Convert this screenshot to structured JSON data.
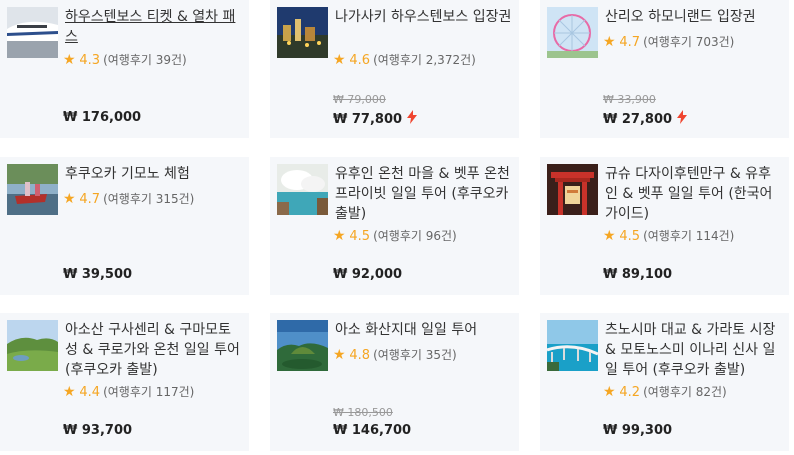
{
  "products": [
    {
      "title": "하우스텐보스 티켓 & 열차 패스",
      "score": "4.3",
      "reviews": "(여행후기 39건)",
      "original_price": "",
      "price": "₩ 176,000",
      "deal": false
    },
    {
      "title": "나가사키 하우스텐보스 입장권",
      "score": "4.6",
      "reviews": "(여행후기 2,372건)",
      "original_price": "₩ 79,000",
      "price": "₩ 77,800",
      "deal": true
    },
    {
      "title": "산리오 하모니랜드 입장권",
      "score": "4.7",
      "reviews": "(여행후기 703건)",
      "original_price": "₩ 33,900",
      "price": "₩ 27,800",
      "deal": true
    },
    {
      "title": "후쿠오카 기모노 체험",
      "score": "4.7",
      "reviews": "(여행후기 315건)",
      "original_price": "",
      "price": "₩ 39,500",
      "deal": false
    },
    {
      "title": "유후인 온천 마을 & 벳푸 온천 프라이빗 일일 투어 (후쿠오카 출발)",
      "score": "4.5",
      "reviews": "(여행후기 96건)",
      "original_price": "",
      "price": "₩ 92,000",
      "deal": false
    },
    {
      "title": "규슈 다자이후텐만구 & 유후인 & 벳푸 일일 투어 (한국어 가이드)",
      "score": "4.5",
      "reviews": "(여행후기 114건)",
      "original_price": "",
      "price": "₩ 89,100",
      "deal": false
    },
    {
      "title": "아소산 구사센리 & 구마모토성 & 쿠로가와 온천 일일 투어 (후쿠오카 출발)",
      "score": "4.4",
      "reviews": "(여행후기 117건)",
      "original_price": "",
      "price": "₩ 93,700",
      "deal": false
    },
    {
      "title": "아소 화산지대 일일 투어",
      "score": "4.8",
      "reviews": "(여행후기 35건)",
      "original_price": "₩ 180,500",
      "price": "₩ 146,700",
      "deal": false
    },
    {
      "title": "츠노시마 대교 & 가라토 시장 & 모토노스미 이나리 신사 일일 투어 (후쿠오카 출발)",
      "score": "4.2",
      "reviews": "(여행후기 82건)",
      "original_price": "",
      "price": "₩ 99,300",
      "deal": false
    }
  ],
  "colors": {
    "star": "#f5a623",
    "deal_bolt": "#f0452f",
    "card_bg": "#f5f7fa"
  },
  "icons": {
    "rating": "star-icon",
    "deal": "lightning-bolt-icon"
  }
}
